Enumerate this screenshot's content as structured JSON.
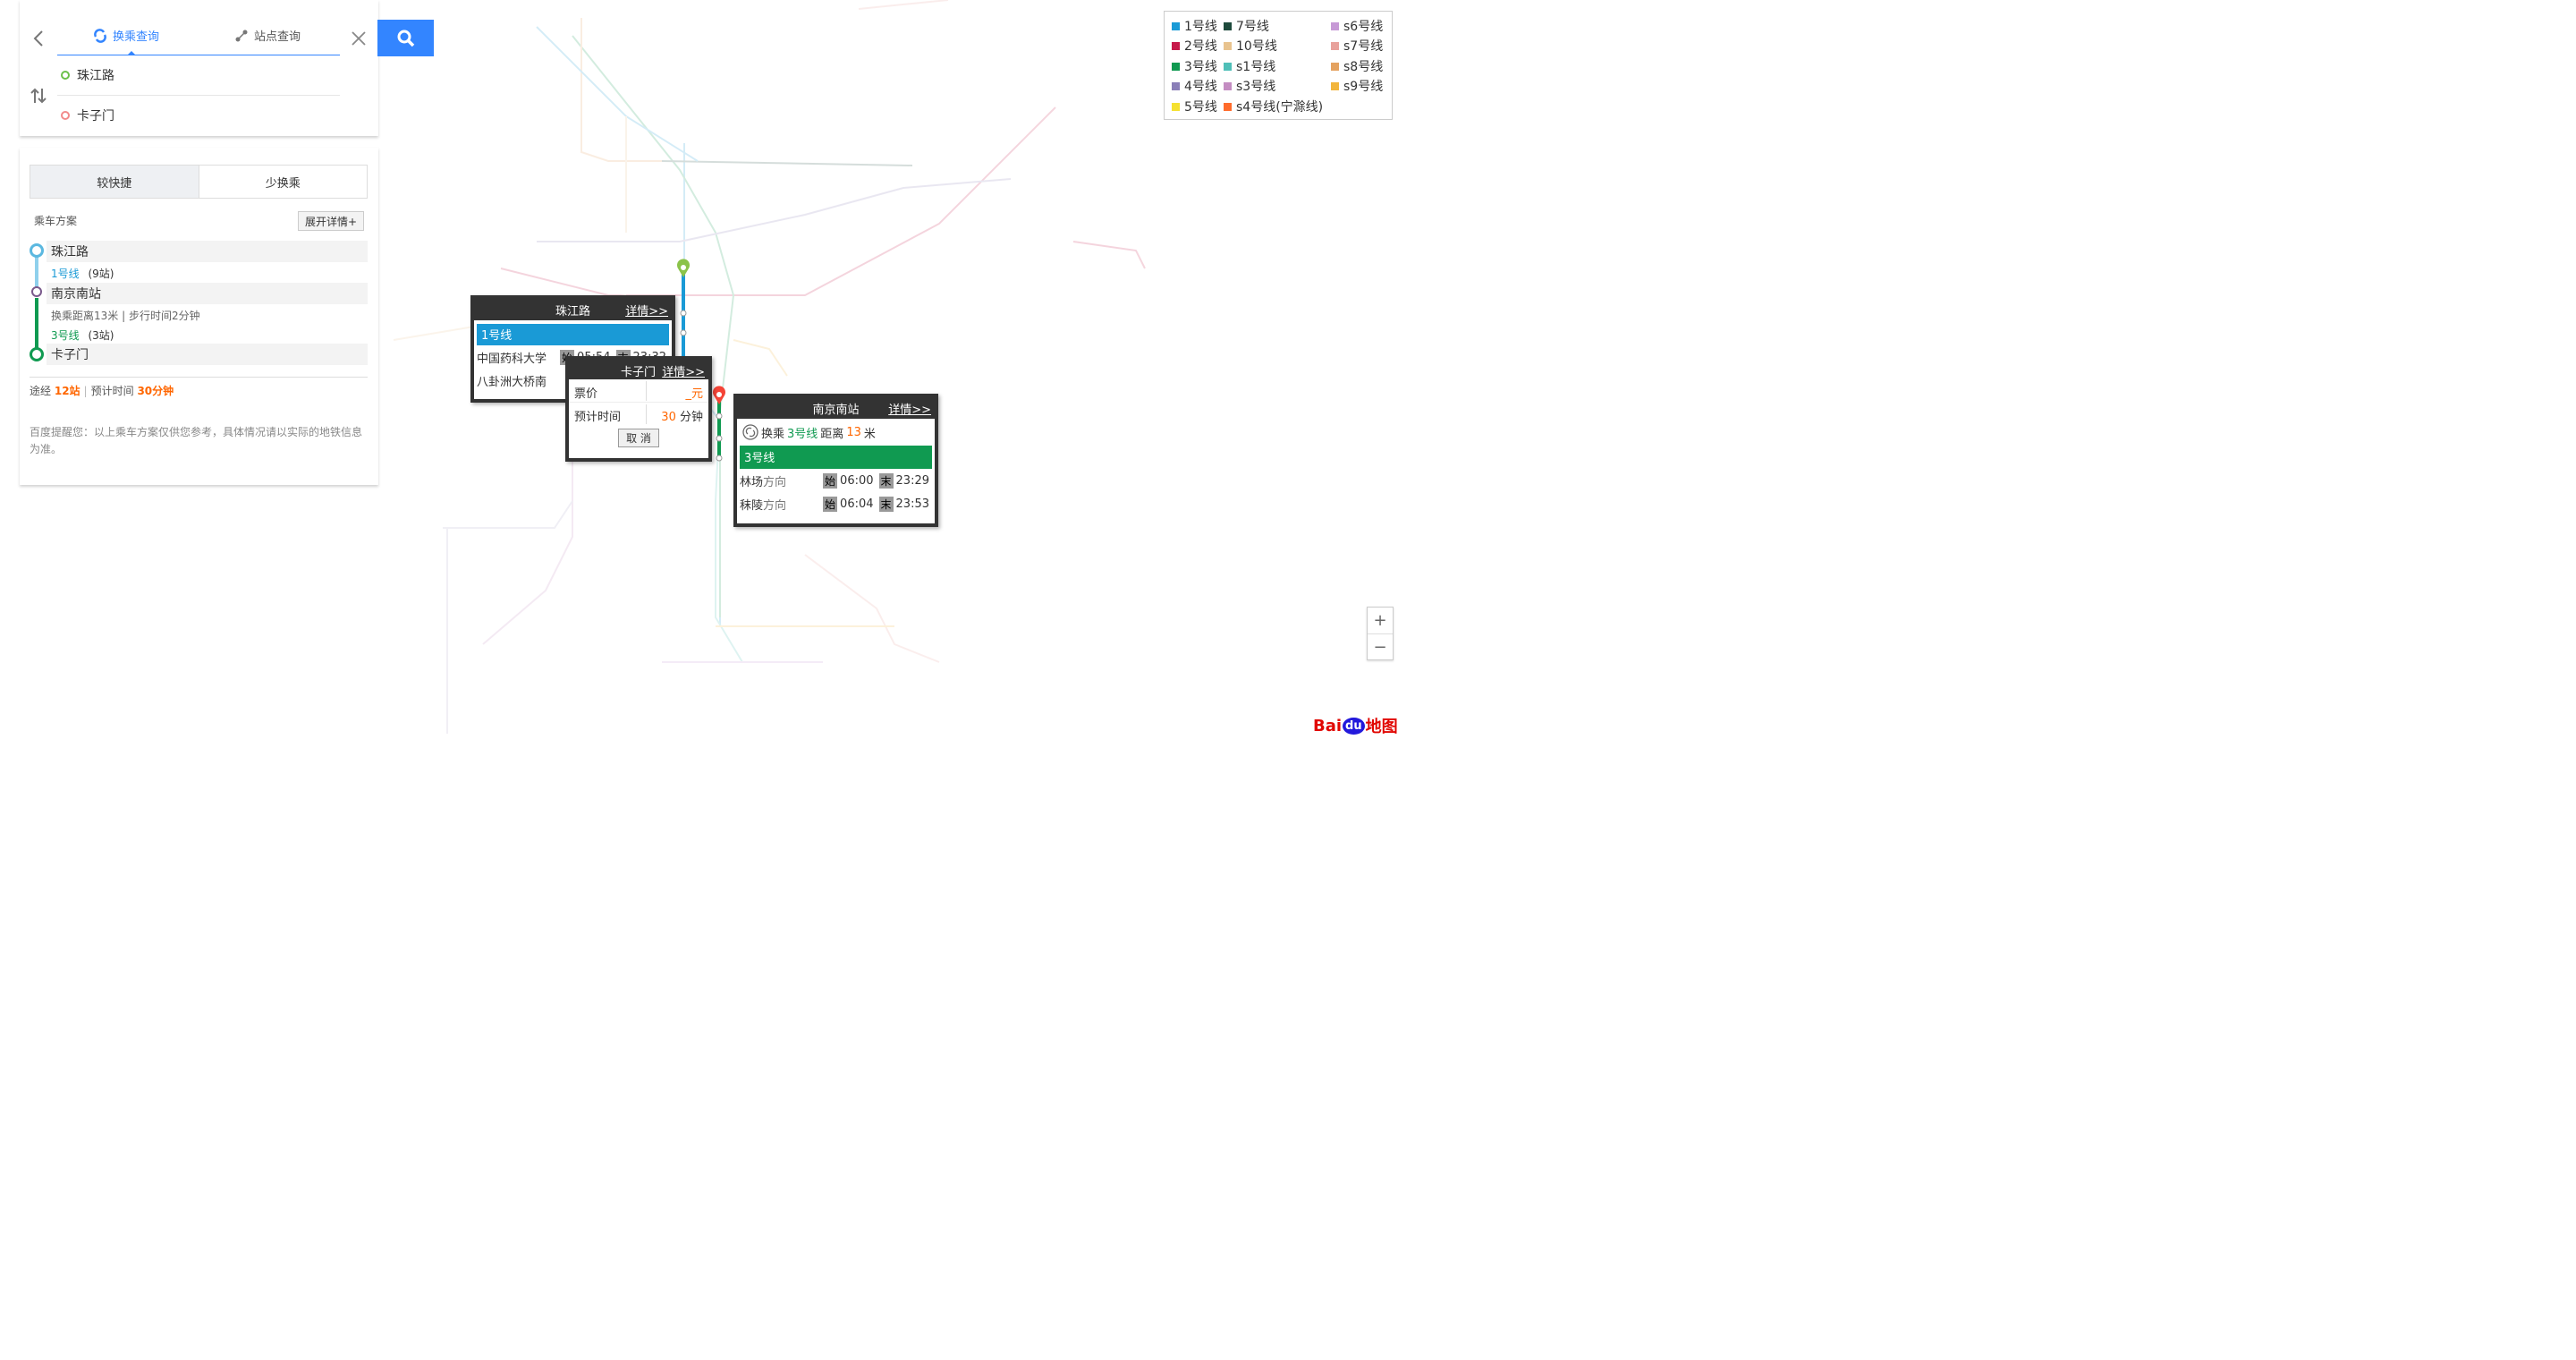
{
  "search": {
    "tab_transfer": "换乘查询",
    "tab_station": "站点查询",
    "from_value": "珠江路",
    "to_value": "卡子门"
  },
  "result": {
    "mode_fast": "较快捷",
    "mode_few_transfers": "少换乘",
    "plan_title": "乘车方案",
    "expand_label": "展开详情+",
    "stops": [
      {
        "name": "珠江路"
      },
      {
        "name": "南京南站"
      },
      {
        "name": "卡子门"
      }
    ],
    "leg1_line": "1号线",
    "leg1_count": "(9站)",
    "transfer_note": "换乘距离13米 | 步行时间2分钟",
    "leg2_line": "3号线",
    "leg2_count": "(3站)",
    "summary_via": "途经",
    "summary_stations": "12站",
    "summary_time_label": "预计时间",
    "summary_time": "30分钟",
    "disclaimer": "百度提醒您：以上乘车方案仅供您参考，具体情况请以实际的地铁信息为准。"
  },
  "legend": {
    "items": [
      {
        "label": "1号线",
        "color": "#1a9ad6"
      },
      {
        "label": "2号线",
        "color": "#c6194a"
      },
      {
        "label": "3号线",
        "color": "#109a51"
      },
      {
        "label": "4号线",
        "color": "#8a7fb8"
      },
      {
        "label": "5号线",
        "color": "#f5e131"
      },
      {
        "label": "7号线",
        "color": "#1e4a3c"
      },
      {
        "label": "10号线",
        "color": "#e8c38e"
      },
      {
        "label": "s1号线",
        "color": "#4fbfb8"
      },
      {
        "label": "s3号线",
        "color": "#c48dc2"
      },
      {
        "label": "s4号线(宁滁线)",
        "color": "#ff6b2b"
      },
      {
        "label": "s6号线",
        "color": "#c79ad6"
      },
      {
        "label": "s7号线",
        "color": "#e8a29c"
      },
      {
        "label": "s8号线",
        "color": "#e4a260"
      },
      {
        "label": "s9号线",
        "color": "#f2b53c"
      }
    ]
  },
  "popup_zhujiang": {
    "title": "珠江路",
    "detail": "详情>>",
    "line": "1号线",
    "dir1": "中国药科大学",
    "dir1_first": "05:54",
    "dir1_last": "23:32",
    "dir2": "八卦洲大桥南",
    "first_badge": "始",
    "last_badge": "末"
  },
  "popup_kazimen": {
    "title": "卡子门",
    "detail": "详情>>",
    "fare_label": "票价",
    "fare_value": "_元",
    "time_label": "预计时间",
    "time_value": "30",
    "time_unit": "分钟",
    "cancel": "取 消"
  },
  "popup_nanjingnan": {
    "title": "南京南站",
    "detail": "详情>>",
    "transfer_prefix": "换乘",
    "transfer_line": "3号线",
    "transfer_mid": "距离",
    "transfer_dist": "13",
    "transfer_unit": "米",
    "line": "3号线",
    "dir1": "林场",
    "dir1_first": "06:00",
    "dir1_last": "23:29",
    "dir2": "秣陵",
    "dir2_first": "06:04",
    "dir2_last": "23:53",
    "dir_suffix": "方向",
    "first_badge": "始",
    "last_badge": "末"
  },
  "logo": {
    "text_a": "Bai",
    "text_b": "du",
    "text_c": "地图"
  },
  "zoom": {
    "in": "+",
    "out": "−"
  }
}
